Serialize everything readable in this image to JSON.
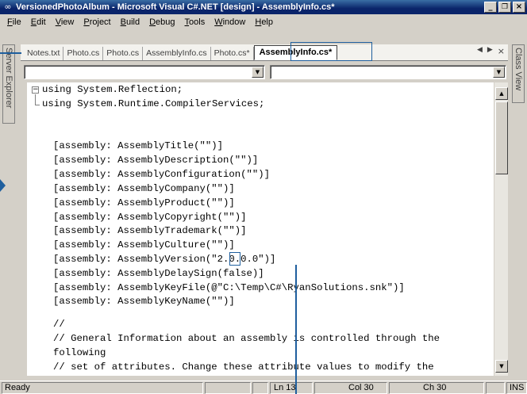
{
  "window": {
    "title": "VersionedPhotoAlbum - Microsoft Visual C#.NET [design] - AssemblyInfo.cs*",
    "app_icon": "vs-infinity-icon",
    "min_label": "_",
    "max_label": "ȩ",
    "close_label": "×"
  },
  "menu": [
    {
      "accel": "F",
      "rest": "ile"
    },
    {
      "accel": "E",
      "rest": "dit"
    },
    {
      "accel": "V",
      "rest": "iew"
    },
    {
      "accel": "P",
      "rest": "roject"
    },
    {
      "accel": "B",
      "rest": "uild"
    },
    {
      "accel": "D",
      "rest": "ebug"
    },
    {
      "accel": "T",
      "rest": "ools"
    },
    {
      "accel": "W",
      "rest": "indow"
    },
    {
      "accel": "H",
      "rest": "elp"
    }
  ],
  "sidebars": {
    "left_label": "Server Explorer",
    "right_label": "Class View"
  },
  "tabs": {
    "items": [
      "Notes.txt",
      "Photo.cs",
      "Photo.cs",
      "AssemblyInfo.cs",
      "Photo.cs*"
    ],
    "active": "AssemblyInfo.cs*",
    "prev_glyph": "◀",
    "next_glyph": "▶",
    "close_glyph": "×"
  },
  "dropdowns": {
    "types_value": "",
    "members_value": "",
    "arrow_glyph": "▼"
  },
  "code": {
    "collapse_glyph": "−",
    "lines": [
      "using System.Reflection;",
      "using System.Runtime.CompilerServices;",
      "",
      "",
      "[assembly: AssemblyTitle(\"\")]",
      "[assembly: AssemblyDescription(\"\")]",
      "[assembly: AssemblyConfiguration(\"\")]",
      "[assembly: AssemblyCompany(\"\")]",
      "[assembly: AssemblyProduct(\"\")]",
      "[assembly: AssemblyCopyright(\"\")]",
      "[assembly: AssemblyTrademark(\"\")]",
      "[assembly: AssemblyCulture(\"\")]",
      "[assembly: AssemblyVersion(\"2.0.0.0\")]",
      "[assembly: AssemblyDelaySign(false)]",
      "[assembly: AssemblyKeyFile(@\"C:\\Temp\\C#\\RyanSolutions.snk\")]",
      "[assembly: AssemblyKeyName(\"\")]",
      "",
      "//",
      "// General Information about an assembly is controlled through the",
      "following",
      "// set of attributes. Change these attribute values to modify the"
    ]
  },
  "scrollbar": {
    "up_glyph": "▲",
    "down_glyph": "▼"
  },
  "status": {
    "message": "Ready",
    "line": "Ln 13",
    "col": "Col 30",
    "ch": "Ch 30",
    "mode": "INS"
  },
  "colors": {
    "callout": "#1f5f9e",
    "titlebar": "#0a246a",
    "chrome": "#d4d0c8"
  }
}
